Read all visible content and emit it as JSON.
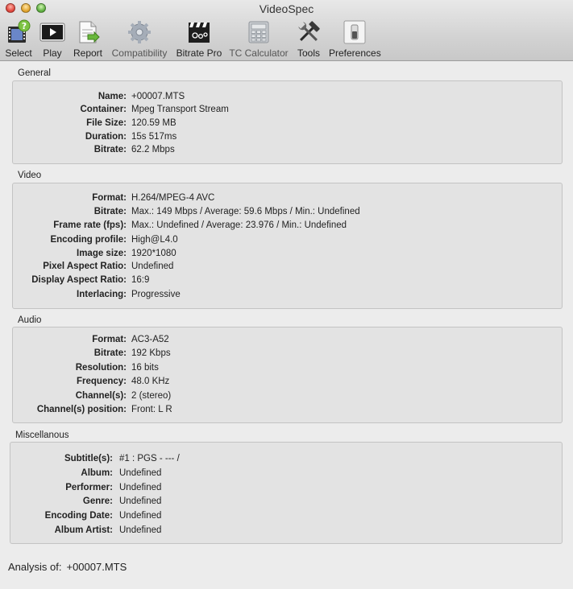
{
  "window": {
    "title": "VideoSpec"
  },
  "toolbar": [
    {
      "id": "select",
      "label": "Select",
      "icon": "film-check-icon"
    },
    {
      "id": "play",
      "label": "Play",
      "icon": "play-screen-icon"
    },
    {
      "id": "report",
      "label": "Report",
      "icon": "report-document-icon"
    },
    {
      "id": "compatibility",
      "label": "Compatibility",
      "icon": "gear-icon"
    },
    {
      "id": "bitrate-pro",
      "label": "Bitrate Pro",
      "icon": "clapperboard-icon"
    },
    {
      "id": "tc-calculator",
      "label": "TC Calculator",
      "icon": "calculator-icon"
    },
    {
      "id": "tools",
      "label": "Tools",
      "icon": "hammer-wrench-icon"
    },
    {
      "id": "preferences",
      "label": "Preferences",
      "icon": "switch-icon"
    }
  ],
  "sections": [
    {
      "id": "general",
      "title": "General",
      "rows": [
        {
          "k": "Name:",
          "v": "+00007.MTS"
        },
        {
          "k": "Container:",
          "v": "Mpeg Transport Stream"
        },
        {
          "k": "File Size:",
          "v": "120.59 MB"
        },
        {
          "k": "Duration:",
          "v": "15s 517ms"
        },
        {
          "k": "Bitrate:",
          "v": "62.2 Mbps"
        }
      ]
    },
    {
      "id": "video",
      "title": "Video",
      "rows": [
        {
          "k": "Format:",
          "v": "H.264/MPEG-4 AVC"
        },
        {
          "k": "Bitrate:",
          "v": "Max.: 149 Mbps / Average: 59.6 Mbps / Min.: Undefined"
        },
        {
          "k": "Frame rate (fps):",
          "v": "Max.: Undefined / Average: 23.976 / Min.: Undefined"
        },
        {
          "k": "Encoding profile:",
          "v": "High@L4.0"
        },
        {
          "k": "Image size:",
          "v": "1920*1080"
        },
        {
          "k": "Pixel Aspect Ratio:",
          "v": "Undefined"
        },
        {
          "k": "Display Aspect Ratio:",
          "v": "16:9"
        },
        {
          "k": "Interlacing:",
          "v": "Progressive"
        }
      ]
    },
    {
      "id": "audio",
      "title": "Audio",
      "rows": [
        {
          "k": "Format:",
          "v": "AC3-A52"
        },
        {
          "k": "Bitrate:",
          "v": "192 Kbps"
        },
        {
          "k": "Resolution:",
          "v": "16 bits"
        },
        {
          "k": "Frequency:",
          "v": "48.0 KHz"
        },
        {
          "k": "Channel(s):",
          "v": "2 (stereo)"
        },
        {
          "k": "Channel(s) position:",
          "v": "Front: L R"
        }
      ]
    },
    {
      "id": "misc",
      "title": "Miscellanous",
      "rows": [
        {
          "k": "Subtitle(s):",
          "v": "#1 : PGS - --- /"
        },
        {
          "k": "Album:",
          "v": "Undefined"
        },
        {
          "k": "Performer:",
          "v": "Undefined"
        },
        {
          "k": "Genre:",
          "v": "Undefined"
        },
        {
          "k": "Encoding Date:",
          "v": "Undefined"
        },
        {
          "k": "Album Artist:",
          "v": "Undefined"
        }
      ]
    }
  ],
  "footer": {
    "label": "Analysis of:",
    "value": "+00007.MTS"
  }
}
